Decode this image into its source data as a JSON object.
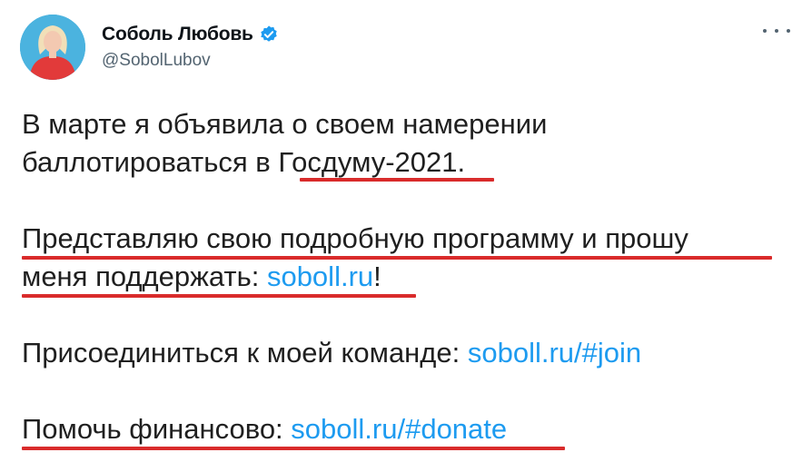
{
  "author": {
    "display_name": "Соболь Любовь",
    "handle": "@SobolLubov",
    "verified_icon": "verified-badge-icon",
    "avatar_icon": "profile-photo"
  },
  "menu": {
    "icon": "more-horizontal-icon"
  },
  "tweet": {
    "line1": "В марте я объявила о своем намерении",
    "line2_text": "баллотироваться в Госдуму-2021.",
    "line3": "Представляю свою подробную программу и прошу",
    "line4_text": "меня поддержать: ",
    "line4_link": "soboll.ru",
    "line4_suffix": "!",
    "line5_text": "Присоединиться к моей команде: ",
    "line5_link": "soboll.ru/#join",
    "line6_text": "Помочь финансово: ",
    "line6_link": "soboll.ru/#donate"
  },
  "colors": {
    "link": "#1d9bf0",
    "underline_mark": "#d92b2b",
    "verified": "#1d9bf0"
  }
}
